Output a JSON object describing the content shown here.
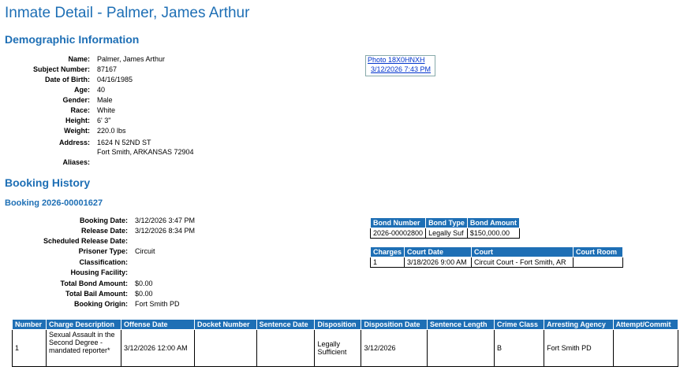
{
  "page_title": "Inmate Detail - Palmer, James Arthur",
  "demographic": {
    "heading": "Demographic Information",
    "fields": [
      {
        "label": "Name:",
        "value": "Palmer, James Arthur"
      },
      {
        "label": "Subject Number:",
        "value": "87167"
      },
      {
        "label": "Date of Birth:",
        "value": "04/16/1985"
      },
      {
        "label": "Age:",
        "value": "40"
      },
      {
        "label": "Gender:",
        "value": "Male"
      },
      {
        "label": "Race:",
        "value": "White"
      },
      {
        "label": "Height:",
        "value": "6' 3\""
      },
      {
        "label": "Weight:",
        "value": "220.0 lbs"
      },
      {
        "label": "Address:",
        "value": "1624 N 52ND ST",
        "value2": "Fort Smith, ARKANSAS 72904"
      },
      {
        "label": "Aliases:",
        "value": ""
      }
    ],
    "photo": {
      "alt": "Photo 18X0HNXH",
      "date": "3/12/2026 7:43 PM"
    }
  },
  "booking_history": {
    "heading": "Booking History",
    "booking_heading": "Booking 2026-00001627",
    "fields": [
      {
        "label": "Booking Date:",
        "value": "3/12/2026 3:47 PM"
      },
      {
        "label": "Release Date:",
        "value": "3/12/2026 8:34 PM"
      },
      {
        "label": "Scheduled Release Date:",
        "value": ""
      },
      {
        "label": "Prisoner Type:",
        "value": "Circuit"
      },
      {
        "label": "Classification:",
        "value": ""
      },
      {
        "label": "Housing Facility:",
        "value": ""
      },
      {
        "label": "Total Bond Amount:",
        "value": "$0.00"
      },
      {
        "label": "Total Bail Amount:",
        "value": "$0.00"
      },
      {
        "label": "Booking Origin:",
        "value": "Fort Smith PD"
      }
    ],
    "bond_table": {
      "headers": [
        "Bond Number",
        "Bond Type",
        "Bond Amount"
      ],
      "rows": [
        [
          "2026-00002800",
          "Legally Suf",
          "$150,000.00"
        ]
      ]
    },
    "court_table": {
      "headers": [
        "Charges",
        "Court Date",
        "Court",
        "Court Room"
      ],
      "rows": [
        [
          "1",
          "3/18/2026 9:00 AM",
          "Circuit Court - Fort Smith, AR",
          ""
        ]
      ]
    },
    "charges_table": {
      "headers": [
        "Number",
        "Charge Description",
        "Offense Date",
        "Docket Number",
        "Sentence Date",
        "Disposition",
        "Disposition Date",
        "Sentence Length",
        "Crime Class",
        "Arresting Agency",
        "Attempt/Commit"
      ],
      "rows": [
        [
          "1",
          "Sexual Assault in the Second Degree - mandated reporter*",
          "3/12/2026 12:00 AM",
          "",
          "",
          "Legally Sufficient",
          "3/12/2026",
          "",
          "B",
          "Fort Smith PD",
          ""
        ]
      ]
    }
  }
}
